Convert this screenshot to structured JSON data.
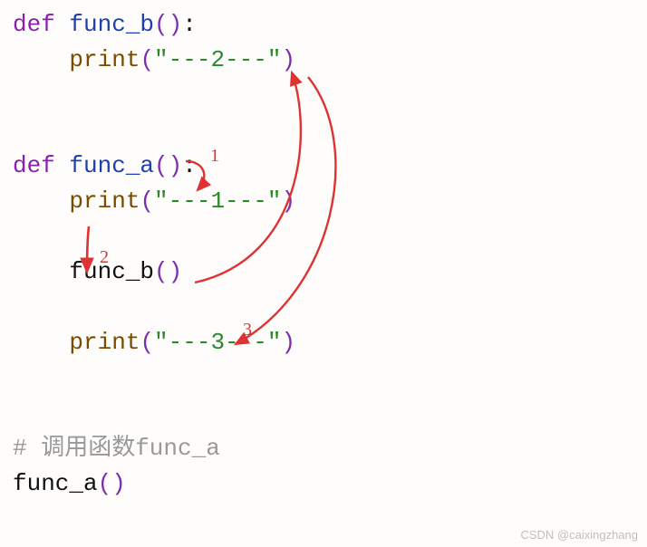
{
  "code": {
    "defkw": "def",
    "func_b_name": "func_b",
    "func_a_name": "func_a",
    "open_paren": "(",
    "close_paren": ")",
    "colon": ":",
    "print_name": "print",
    "str2": "\"---2---\"",
    "str1": "\"---1---\"",
    "str3": "\"---3---\"",
    "call_b": "func_b",
    "comment": "# 调用函数func_a",
    "call_a": "func_a"
  },
  "annotations": {
    "label1": "1",
    "label2": "2",
    "label3": "3"
  },
  "watermark": "CSDN @caixingzhang"
}
